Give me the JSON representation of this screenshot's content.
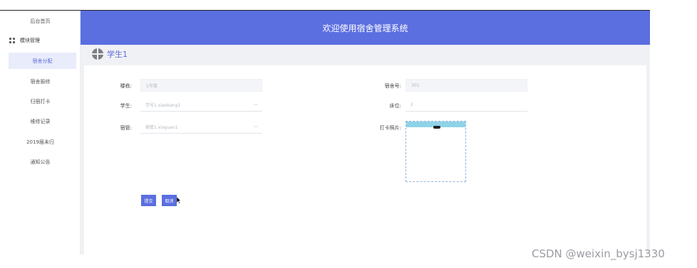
{
  "app": {
    "header_title": "欢迎使用宿舍管理系统"
  },
  "sidebar": {
    "home": "后台首页",
    "module": "模块管理",
    "items": [
      {
        "label": "宿舍分配",
        "active": true
      },
      {
        "label": "宿舍报修",
        "active": false
      },
      {
        "label": "归宿打卡",
        "active": false
      },
      {
        "label": "维修记录",
        "active": false
      },
      {
        "label": "2019届未归",
        "active": false
      },
      {
        "label": "通知公告",
        "active": false
      }
    ]
  },
  "breadcrumb": {
    "icon": "dorm-icon",
    "text": "学生1"
  },
  "form": {
    "building_label": "楼栋:",
    "building_value": "1号楼",
    "room_label": "宿舍号:",
    "room_value": "301",
    "student_label": "学生:",
    "student_value": "学号1.xiaobang1",
    "bed_label": "床位:",
    "bed_value": "2",
    "manager_label": "宿管:",
    "manager_value": "宿管1.xiaguan1",
    "photo_label": "打卡照片:",
    "submit_label": "提交",
    "cancel_label": "取消"
  },
  "watermark": "CSDN @weixin_bysj1330",
  "colors": {
    "accent": "#5b6fe0",
    "active_bg": "#e9ecfb",
    "page_bg": "#f0f1f4"
  }
}
